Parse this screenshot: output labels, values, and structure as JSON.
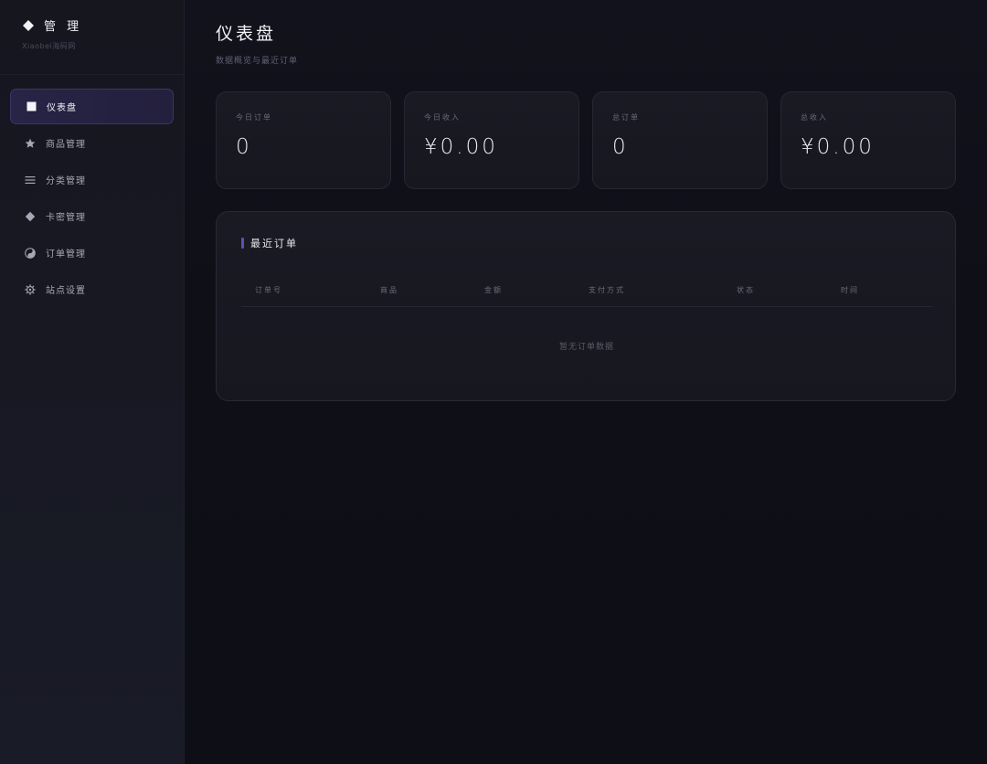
{
  "brand": {
    "title": "管 理",
    "subtitle": "Xiaobei海码网"
  },
  "sidebar": {
    "items": [
      {
        "label": "仪表盘",
        "icon": "square-icon",
        "active": true
      },
      {
        "label": "商品管理",
        "icon": "star-icon",
        "active": false
      },
      {
        "label": "分类管理",
        "icon": "menu-icon",
        "active": false
      },
      {
        "label": "卡密管理",
        "icon": "diamond-icon",
        "active": false
      },
      {
        "label": "订单管理",
        "icon": "yin-yang-icon",
        "active": false
      },
      {
        "label": "站点设置",
        "icon": "gear-icon",
        "active": false
      }
    ]
  },
  "header": {
    "title": "仪表盘",
    "subtitle": "数据概览与最近订单"
  },
  "stats": [
    {
      "label": "今日订单",
      "value": "0"
    },
    {
      "label": "今日收入",
      "value": "¥0.00"
    },
    {
      "label": "总订单",
      "value": "0"
    },
    {
      "label": "总收入",
      "value": "¥0.00"
    }
  ],
  "orders": {
    "title": "最近订单",
    "columns": [
      "订单号",
      "商品",
      "金额",
      "支付方式",
      "状态",
      "时间"
    ],
    "empty_text": "暂无订单数据"
  },
  "colors": {
    "accent": "#5b50b5",
    "active_bg": "#272446",
    "background": "#0e0e16"
  }
}
